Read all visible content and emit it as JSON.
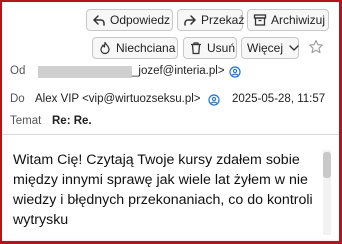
{
  "toolbar": {
    "reply_label": "Odpowiedz",
    "forward_label": "Przekaż",
    "archive_label": "Archiwizuj",
    "junk_label": "Niechciana",
    "delete_label": "Usuń",
    "more_label": "Więcej"
  },
  "header": {
    "from_label": "Od",
    "from_value": "_jozef@interia.pl>",
    "to_label": "Do",
    "to_value": "Alex VIP <vip@wirtuozseksu.pl>",
    "date": "2025-05-28, 11:57",
    "subject_label": "Temat",
    "subject_value": "Re: Re."
  },
  "message": {
    "body": "Witam Cię! Czytają Twoje kursy zdałem sobie między innymi sprawę jak wiele lat żyłem w nie wiedzy i błędnych przekonaniach, co do kontroli wytrysku"
  },
  "icons": {
    "reply": "reply-icon",
    "forward": "forward-icon",
    "archive": "archive-icon",
    "junk": "flame-icon",
    "delete": "trash-icon",
    "more": "chevron-down-icon",
    "star": "star-icon",
    "contact": "contact-icon"
  },
  "colors": {
    "frame": "#b3141e",
    "link_icon": "#1a73e8",
    "button_bg": "#f7f7f7"
  }
}
